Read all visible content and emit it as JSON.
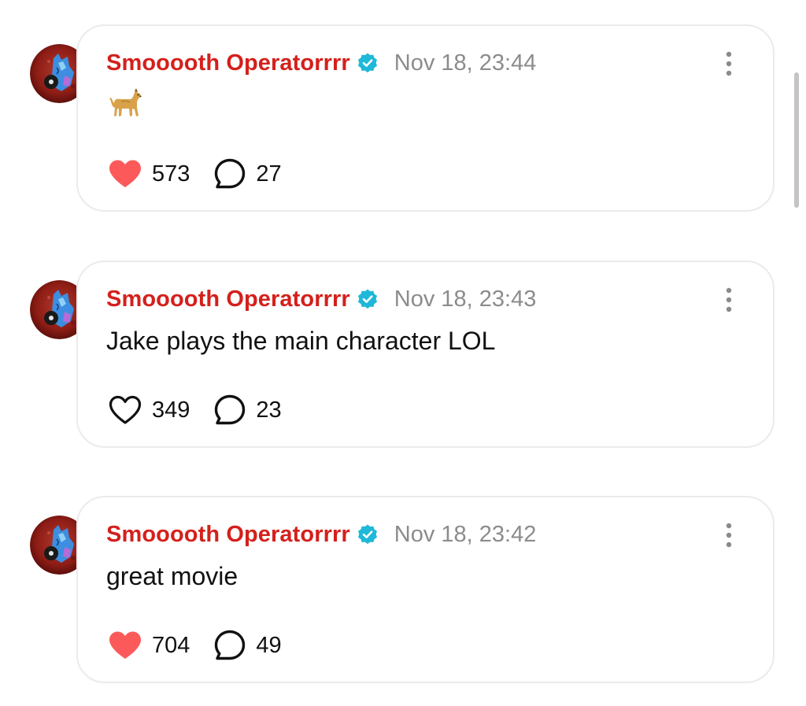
{
  "comments": [
    {
      "username": "Smooooth Operatorrrr",
      "verified": true,
      "timestamp": "Nov 18, 23:44",
      "text": "",
      "emoji": "dog-emoji",
      "likes": "573",
      "liked": true,
      "replies": "27"
    },
    {
      "username": "Smooooth Operatorrrr",
      "verified": true,
      "timestamp": "Nov 18, 23:43",
      "text": "Jake plays the main character LOL",
      "likes": "349",
      "liked": false,
      "replies": "23"
    },
    {
      "username": "Smooooth Operatorrrr",
      "verified": true,
      "timestamp": "Nov 18, 23:42",
      "text": "great movie",
      "likes": "704",
      "liked": true,
      "replies": "49"
    }
  ],
  "colors": {
    "username": "#d4201c",
    "timestamp": "#8c8c8c",
    "verified_badge": "#1fb8d8",
    "heart_filled": "#fc5a5a",
    "card_border": "#ebebed"
  },
  "icons": {
    "avatar": "avatar",
    "verified": "verified-badge-icon",
    "more": "more-vertical-icon",
    "like": "heart-icon",
    "reply": "comment-bubble-icon"
  }
}
